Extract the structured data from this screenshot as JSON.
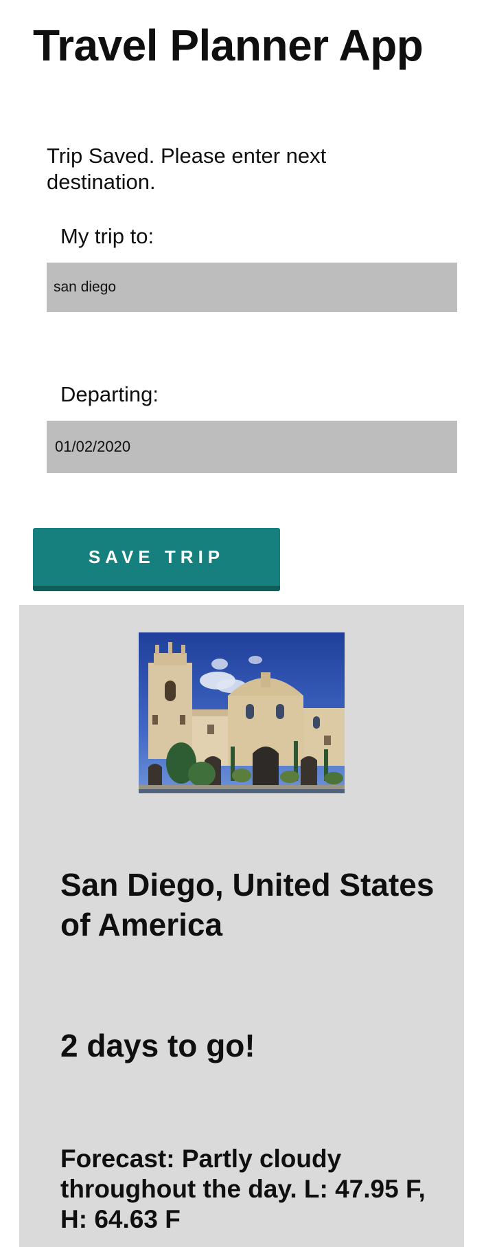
{
  "app": {
    "title": "Travel Planner App"
  },
  "form": {
    "status_message": "Trip Saved. Please enter next destination.",
    "destination_label": "My trip to:",
    "destination_value": "san diego",
    "departing_label": "Departing:",
    "departing_value": "01/02/2020",
    "save_button_label": "SAVE TRIP"
  },
  "result": {
    "photo_icon": "destination-photo",
    "location": "San Diego, United States of America",
    "countdown": "2 days to go!",
    "forecast": "Forecast: Partly cloudy throughout the day. L: 47.95 F, H: 64.63 F"
  },
  "colors": {
    "accent": "#15807d",
    "input_bg": "#bdbdbd",
    "panel_bg": "#dadada"
  }
}
